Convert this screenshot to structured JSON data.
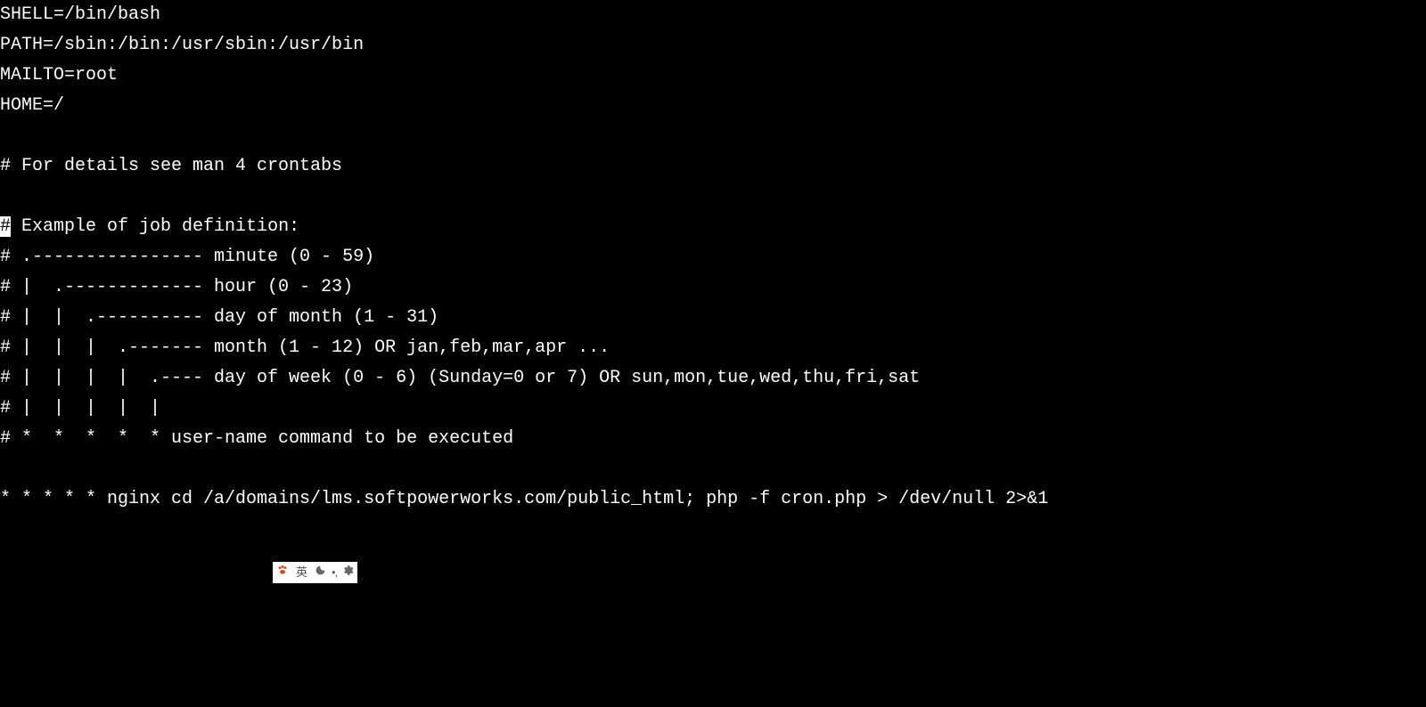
{
  "terminal": {
    "lines": [
      "SHELL=/bin/bash",
      "PATH=/sbin:/bin:/usr/sbin:/usr/bin",
      "MAILTO=root",
      "HOME=/",
      "",
      "# For details see man 4 crontabs",
      "",
      "# Example of job definition:",
      "# .---------------- minute (0 - 59)",
      "# |  .------------- hour (0 - 23)",
      "# |  |  .---------- day of month (1 - 31)",
      "# |  |  |  .------- month (1 - 12) OR jan,feb,mar,apr ...",
      "# |  |  |  |  .---- day of week (0 - 6) (Sunday=0 or 7) OR sun,mon,tue,wed,thu,fri,sat",
      "# |  |  |  |  |",
      "# *  *  *  *  * user-name command to be executed",
      "",
      "* * * * * nginx cd /a/domains/lms.softpowerworks.com/public_html; php -f cron.php > /dev/null 2>&1"
    ],
    "cursor_line_index": 7,
    "cursor_char": "#"
  },
  "ime": {
    "paw": "⚙",
    "lang": "英",
    "moon": "☽",
    "dots": "•,",
    "gear": "⚙"
  }
}
